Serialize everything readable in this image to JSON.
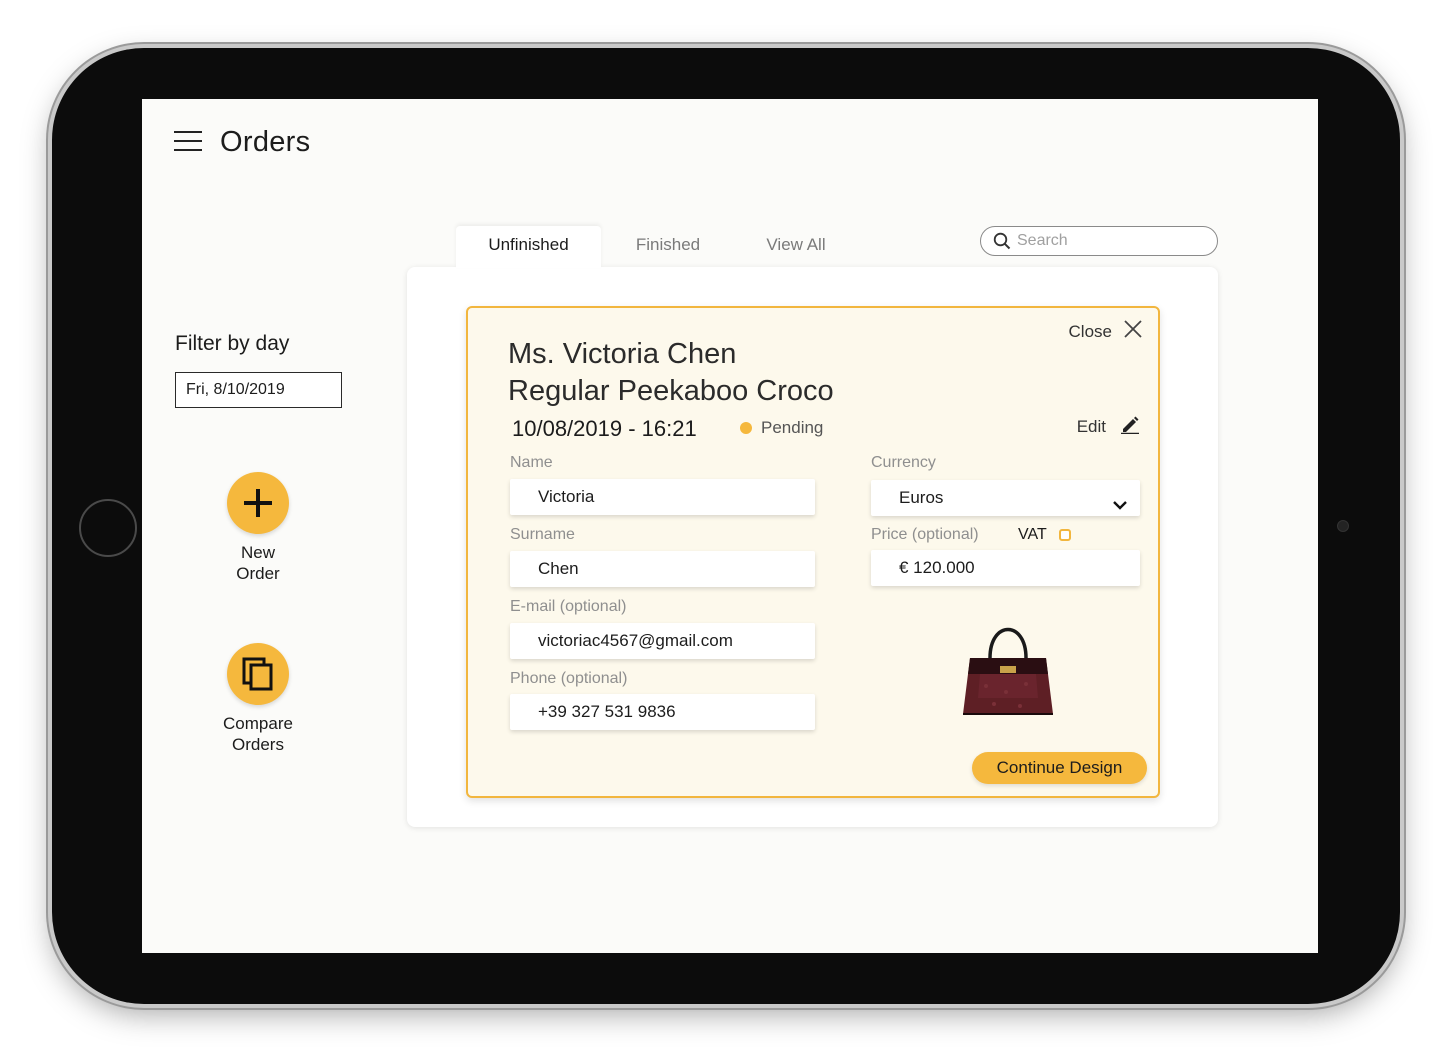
{
  "header": {
    "title": "Orders"
  },
  "sidebar": {
    "filter_label": "Filter by day",
    "filter_value": "Fri, 8/10/2019",
    "actions": [
      {
        "label_line1": "New",
        "label_line2": "Order",
        "icon": "plus-icon"
      },
      {
        "label_line1": "Compare",
        "label_line2": "Orders",
        "icon": "copy-icon"
      }
    ]
  },
  "tabs": [
    {
      "label": "Unfinished",
      "active": true
    },
    {
      "label": "Finished",
      "active": false
    },
    {
      "label": "View All",
      "active": false
    }
  ],
  "search": {
    "placeholder": "Search",
    "icon": "search-icon"
  },
  "order_card": {
    "close_label": "Close",
    "customer_name": "Ms. Victoria Chen",
    "product": "Regular Peekaboo Croco",
    "datetime": "10/08/2019 - 16:21",
    "status": "Pending",
    "edit_label": "Edit",
    "fields": {
      "name_label": "Name",
      "name_value": "Victoria",
      "surname_label": "Surname",
      "surname_value": "Chen",
      "email_label": "E-mail (optional)",
      "email_value": "victoriac4567@gmail.com",
      "phone_label": "Phone (optional)",
      "phone_value": "+39 327 531 9836",
      "currency_label": "Currency",
      "currency_value": "Euros",
      "price_label": "Price (optional)",
      "price_value": "€ 120.000",
      "vat_label": "VAT"
    },
    "continue_label": "Continue Design"
  },
  "colors": {
    "accent": "#f5b83d",
    "card_border": "#f2b63e",
    "card_bg": "#fdf9ec",
    "screen_bg": "#fbfbf9"
  }
}
